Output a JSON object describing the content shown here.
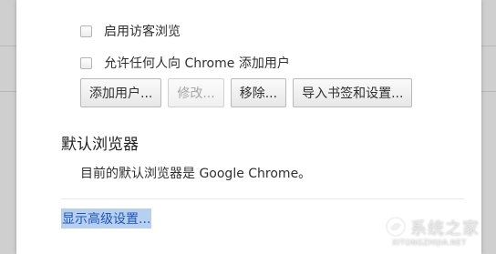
{
  "options": {
    "guest_browsing_label": "启用访客浏览",
    "anyone_add_user_label": "允许任何人向 Chrome 添加用户"
  },
  "buttons": {
    "add_user": "添加用户...",
    "edit": "修改...",
    "remove": "移除...",
    "import_bookmarks": "导入书签和设置..."
  },
  "default_browser": {
    "title": "默认浏览器",
    "description": "目前的默认浏览器是 Google Chrome。"
  },
  "advanced_link": "显示高级设置...",
  "watermark": {
    "text_cn": "系统之家",
    "text_en": "XITONGZHIJIA.NET"
  },
  "colors": {
    "link": "#2255b8",
    "link_highlight": "#b7d0f0"
  }
}
